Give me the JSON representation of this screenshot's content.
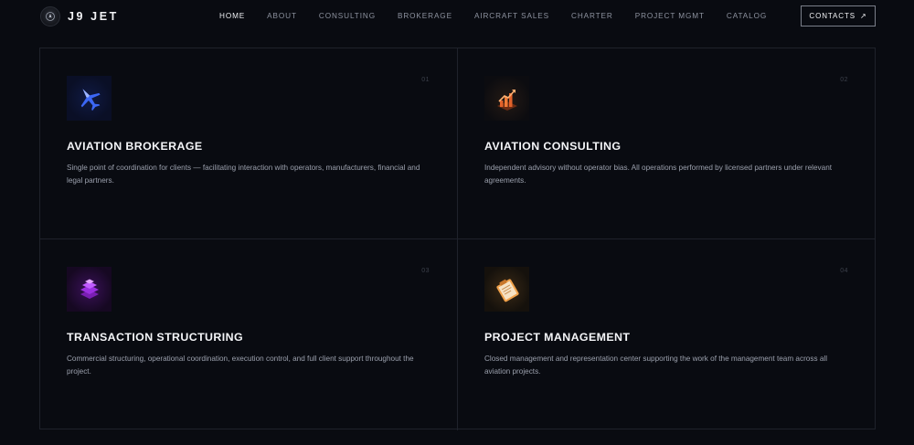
{
  "header": {
    "logo_text": "J9 JET",
    "nav": [
      {
        "label": "HOME",
        "active": true
      },
      {
        "label": "ABOUT",
        "active": false
      },
      {
        "label": "CONSULTING",
        "active": false
      },
      {
        "label": "BROKERAGE",
        "active": false
      },
      {
        "label": "AIRCRAFT SALES",
        "active": false
      },
      {
        "label": "CHARTER",
        "active": false
      },
      {
        "label": "PROJECT MGMT",
        "active": false
      },
      {
        "label": "CATALOG",
        "active": false
      }
    ],
    "contacts_label": "CONTACTS",
    "contacts_arrow": "↗"
  },
  "services": [
    {
      "num": "01",
      "icon": "plane-icon",
      "title": "AVIATION BROKERAGE",
      "description": "Single point of coordination for clients — facilitating interaction with operators, manufacturers, financial and legal partners."
    },
    {
      "num": "02",
      "icon": "chart-icon",
      "title": "AVIATION CONSULTING",
      "description": "Independent advisory without operator bias. All operations performed by licensed partners under relevant agreements."
    },
    {
      "num": "03",
      "icon": "layers-icon",
      "title": "TRANSACTION STRUCTURING",
      "description": "Commercial structuring, operational coordination, execution control, and full client support throughout the project."
    },
    {
      "num": "04",
      "icon": "clipboard-icon",
      "title": "PROJECT MANAGEMENT",
      "description": "Closed management and representation center supporting the work of the management team across all aviation projects."
    }
  ],
  "colors": {
    "background": "#090b11",
    "grid_line": "#1f222b",
    "nav_inactive": "#8e93a0",
    "nav_active": "#eef0f4",
    "plane_accent": "#3f6bff",
    "chart_accent": "#e2622a",
    "layers_accent": "#b13cf0",
    "clipboard_accent": "#f0a14a"
  }
}
